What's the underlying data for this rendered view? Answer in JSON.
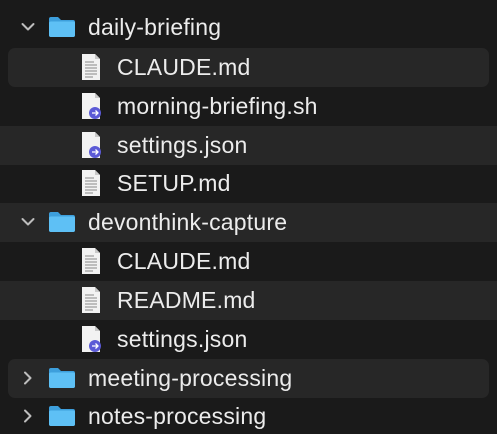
{
  "tree": [
    {
      "kind": "folder",
      "name": "daily-briefing",
      "expanded": true,
      "icon": "folder-icon",
      "chevron": "chevron-down-icon"
    },
    {
      "kind": "file",
      "name": "CLAUDE.md",
      "icon": "markdown-file-icon"
    },
    {
      "kind": "file",
      "name": "morning-briefing.sh",
      "icon": "script-file-icon"
    },
    {
      "kind": "file",
      "name": "settings.json",
      "icon": "script-file-icon"
    },
    {
      "kind": "file",
      "name": "SETUP.md",
      "icon": "markdown-file-icon"
    },
    {
      "kind": "folder",
      "name": "devonthink-capture",
      "expanded": true,
      "icon": "folder-icon",
      "chevron": "chevron-down-icon"
    },
    {
      "kind": "file",
      "name": "CLAUDE.md",
      "icon": "markdown-file-icon"
    },
    {
      "kind": "file",
      "name": "README.md",
      "icon": "markdown-file-icon"
    },
    {
      "kind": "file",
      "name": "settings.json",
      "icon": "script-file-icon"
    },
    {
      "kind": "folder",
      "name": "meeting-processing",
      "expanded": false,
      "icon": "folder-icon",
      "chevron": "chevron-right-icon"
    },
    {
      "kind": "folder",
      "name": "notes-processing",
      "expanded": false,
      "icon": "folder-icon",
      "chevron": "chevron-right-icon"
    }
  ],
  "colors": {
    "background": "#1a1a1a",
    "alternate_row": "#272727",
    "folder_blue": "#4fb3f0",
    "text": "#ececec",
    "script_badge": "#5b5ad6"
  }
}
